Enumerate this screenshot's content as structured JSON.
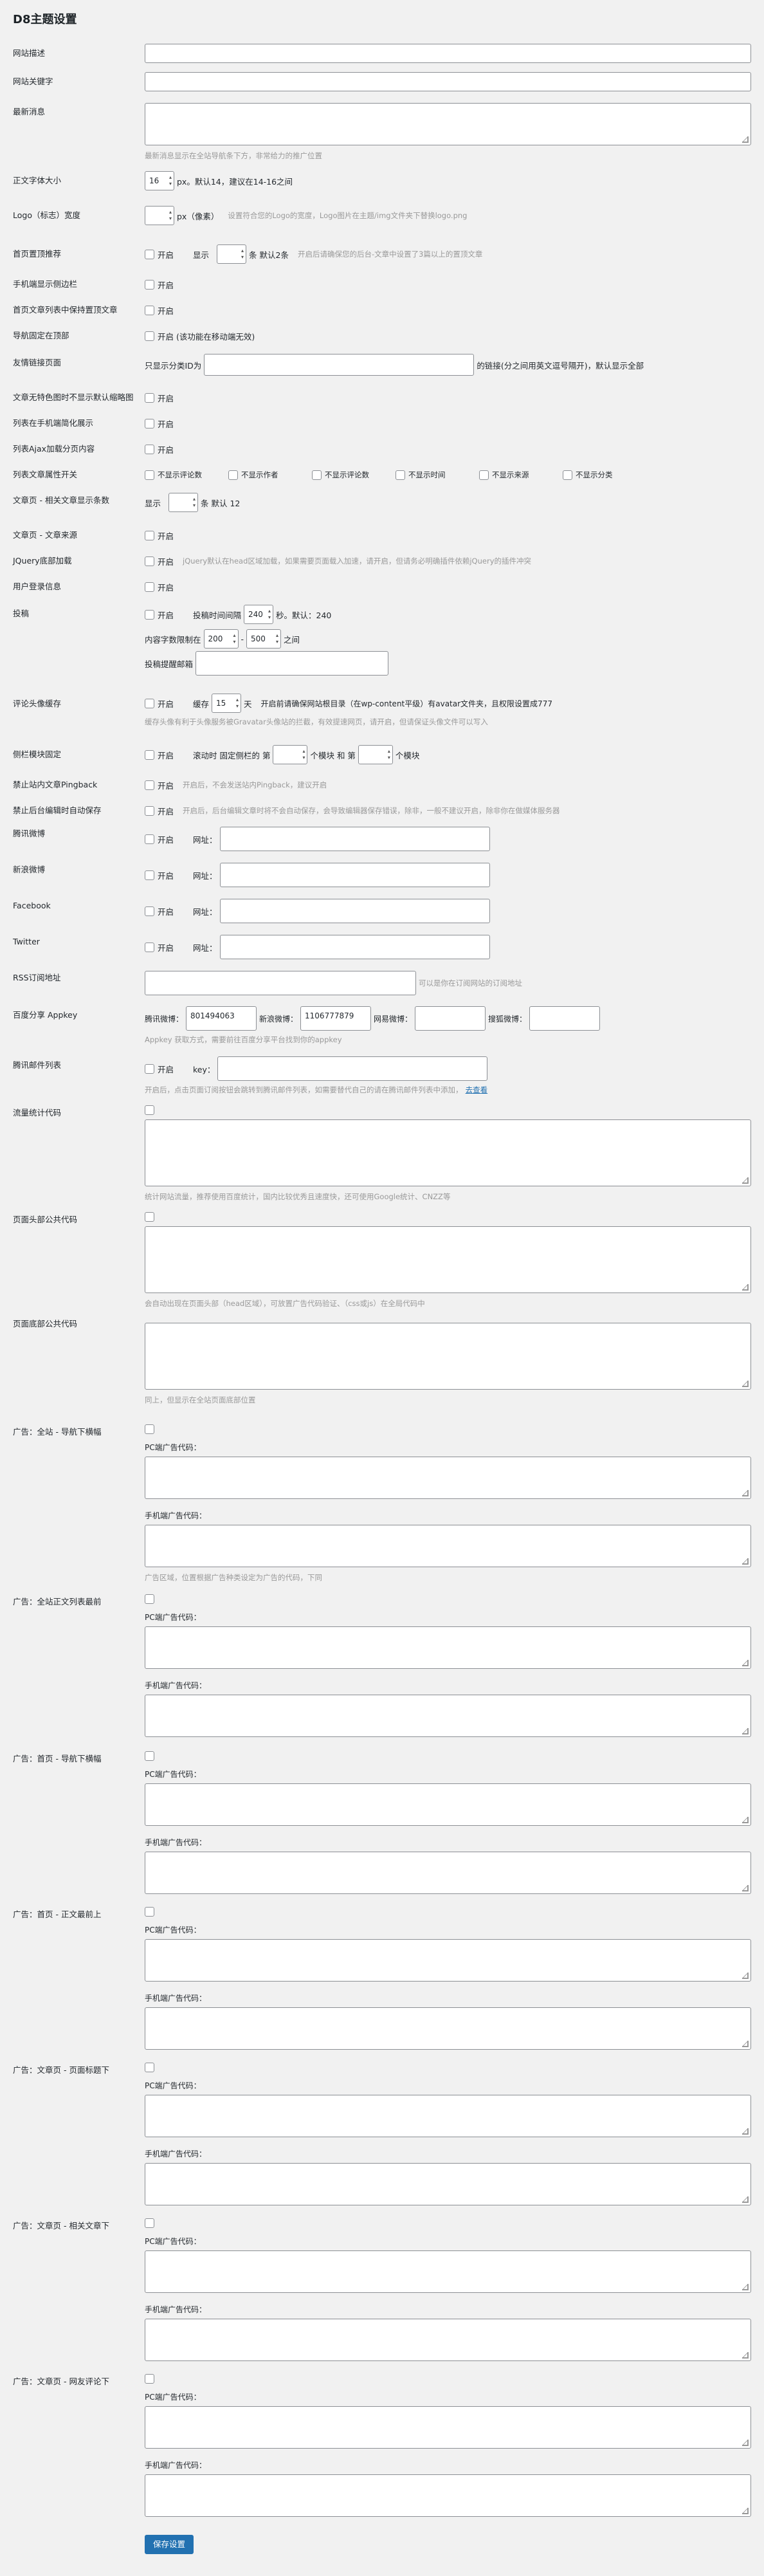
{
  "page_title": "D8主题设置",
  "labels": {
    "site_desc": "网站描述",
    "site_keywords": "网站关键字",
    "latest_news": "最新消息",
    "font_size": "正文字体大小",
    "logo_width": "Logo（标志）宽度",
    "home_top": "首页置顶推荐",
    "mobile_sidebar": "手机端显示侧边栏",
    "home_list_top": "首页文章列表中保持置顶文章",
    "nav_fixed": "导航固定在顶部",
    "friend_links": "友情链接页面",
    "no_thumb": "文章无特色图时不显示默认缩略图",
    "list_mobile": "列表在手机端简化展示",
    "list_ajax": "列表Ajax加载分页内容",
    "list_attrs": "列表文章属性开关",
    "related_count": "文章页 - 相关文章显示条数",
    "post_source": "文章页 - 文章来源",
    "jquery_footer": "JQuery底部加载",
    "user_login": "用户登录信息",
    "contribute": "投稿",
    "avatar_cache": "评论头像缓存",
    "sidebar_fixed": "侧栏模块固定",
    "no_pingback": "禁止站内文章Pingback",
    "no_autosave": "禁止后台编辑时自动保存",
    "tencent_weibo": "腾讯微博",
    "sina_weibo": "新浪微博",
    "facebook": "Facebook",
    "twitter": "Twitter",
    "rss": "RSS订阅地址",
    "baidu_share": "百度分享 Appkey",
    "tencent_mail": "腾讯邮件列表",
    "stats_code": "流量统计代码",
    "header_code": "页面头部公共代码",
    "footer_code": "页面底部公共代码",
    "ad_site_nav": "广告：全站 - 导航下横幅",
    "ad_site_list": "广告：全站正文列表最前",
    "ad_home_nav": "广告：首页 - 导航下横幅",
    "ad_home_list": "广告：首页 - 正文最前上",
    "ad_post_title": "广告：文章页 - 页面标题下",
    "ad_post_related": "广告：文章页 - 相关文章下",
    "ad_post_comment": "广告：文章页 - 网友评论下"
  },
  "help": {
    "latest_news": "最新消息显示在全站导航条下方，非常给力的推广位置",
    "logo_width": "设置符合您的Logo的宽度，Logo图片在主题/img文件夹下替换logo.png",
    "home_top": "开启后请确保您的后台-文章中设置了3篇以上的置顶文章",
    "jquery_footer": "jQuery默认在head区域加载，如果需要页面载入加速，请开启，但请务必明确插件依赖jQuery的插件冲突",
    "avatar_cache": "缓存头像有利于头像服务被Gravatar头像站的拦截，有效提速网页，请开启，但请保证头像文件可以写入",
    "no_pingback": "开启后，不会发送站内Pingback，建议开启",
    "no_autosave": "开启后，后台编辑文章时将不会自动保存，会导致编辑器保存错误，除非，一般不建议开启，除非你在做媒体服务器",
    "rss": "可以是你在订阅网站的订阅地址",
    "baidu_share": "Appkey 获取方式，需要前往百度分享平台找到你的appkey",
    "tencent_mail": "开启后，点击页面订阅按钮会跳转到腾讯邮件列表，如需要替代自己的请在腾讯邮件列表中添加，",
    "tencent_mail_link": "去查看",
    "stats_code": "统计网站流量，推荐使用百度统计，国内比较优秀且速度快，还可使用Google统计、CNZZ等",
    "header_code": "会自动出现在页面头部（head区域），可放置广告代码验证、（css或js）在全局代码中",
    "footer_code": "同上，但显示在全站页面底部位置",
    "ad_site_nav": "广告区域，位置根据广告种类设定为广告的代码，下同"
  },
  "texts": {
    "enable": "开启",
    "px_default_14": "px。默认14，建议在14-16之间",
    "px_pic": "px（像素）",
    "show": "显示",
    "items_default_2": "条 默认2条",
    "nav_fixed_note": "开启 (该功能在移动端无效)",
    "friend_links_prefix": "只显示分类ID为",
    "friend_links_suffix": "的链接(分之间用英文逗号隔开)，默认显示全部",
    "related_suffix": "条 默认 12",
    "contribute_interval": "投稿时间间隔",
    "contribute_interval_suffix": "秒。默认：240",
    "contribute_len": "内容字数限制在",
    "contribute_between": "之间",
    "contribute_email": "投稿提醒邮箱",
    "cache_prefix": "缓存",
    "cache_suffix": "天",
    "cache_note": "开启前请确保网站根目录（在wp-content平级）有avatar文件夹，且权限设置成777",
    "sidebar_fixed_prefix": "滚动时 固定侧栏的 第",
    "sidebar_fixed_mid": "个模块 和 第",
    "sidebar_fixed_suffix": "个模块",
    "url": "网址：",
    "baidu_tencent": "腾讯微博：",
    "baidu_sina": "新浪微博：",
    "baidu_163": "网易微博：",
    "baidu_sohu": "搜狐微博：",
    "key": "key：",
    "pc_code": "PC端广告代码：",
    "mobile_code": "手机端广告代码：",
    "save": "保存设置"
  },
  "values": {
    "font_size": "16",
    "related_count": "",
    "interval": "240",
    "len_min": "200",
    "len_max": "500",
    "cache_days": "15",
    "tencent_key": "801494063",
    "sina_key": "1106777879"
  },
  "list_attrs": [
    "不显示评论数",
    "不显示作者",
    "不显示评论数",
    "不显示时间",
    "不显示来源",
    "不显示分类"
  ]
}
